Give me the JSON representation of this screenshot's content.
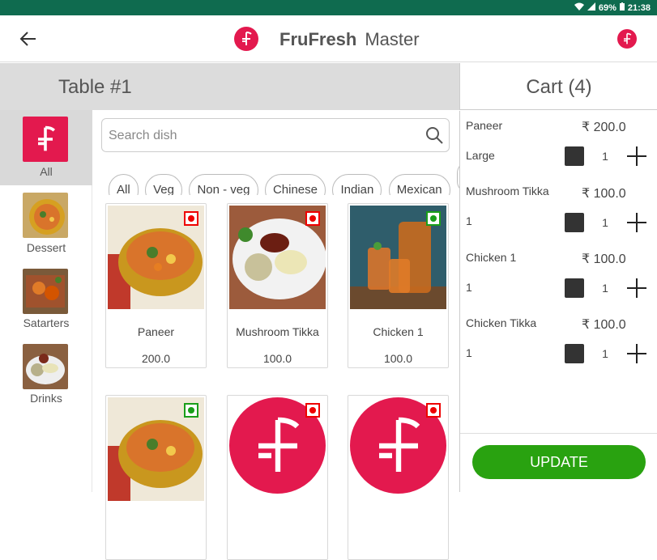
{
  "status": {
    "battery": "69%",
    "time": "21:38"
  },
  "app": {
    "title_bold": "FruFresh",
    "title_rest": "Master"
  },
  "table": {
    "label": "Table #1"
  },
  "cart": {
    "label": "Cart (4)"
  },
  "categories": [
    {
      "label": "All"
    },
    {
      "label": "Dessert"
    },
    {
      "label": "Satarters"
    },
    {
      "label": "Drinks"
    }
  ],
  "search": {
    "placeholder": "Search dish"
  },
  "filters": [
    "All",
    "Veg",
    "Non - veg",
    "Chinese",
    "Indian",
    "Mexican"
  ],
  "dishes": [
    {
      "name": "Paneer",
      "price": "200.0",
      "badge": "non-veg"
    },
    {
      "name": "Mushroom Tikka",
      "price": "100.0",
      "badge": "non-veg"
    },
    {
      "name": "Chicken 1",
      "price": "100.0",
      "badge": "veg"
    },
    {
      "name": "",
      "price": "",
      "badge": "veg"
    },
    {
      "name": "",
      "price": "",
      "badge": "non-veg"
    },
    {
      "name": "",
      "price": "",
      "badge": "non-veg"
    }
  ],
  "cart_items": [
    {
      "name": "Paneer",
      "price": "₹ 200.0",
      "sub": "Large",
      "qty": "1"
    },
    {
      "name": "Mushroom Tikka",
      "price": "₹ 100.0",
      "sub": "1",
      "qty": "1"
    },
    {
      "name": "Chicken 1",
      "price": "₹ 100.0",
      "sub": "1",
      "qty": "1"
    },
    {
      "name": "Chicken Tikka",
      "price": "₹ 100.0",
      "sub": "1",
      "qty": "1"
    }
  ],
  "update_label": "UPDATE",
  "colors": {
    "brand": "#e3194e",
    "statusbar": "#0f6b4f",
    "update": "#29a210"
  }
}
